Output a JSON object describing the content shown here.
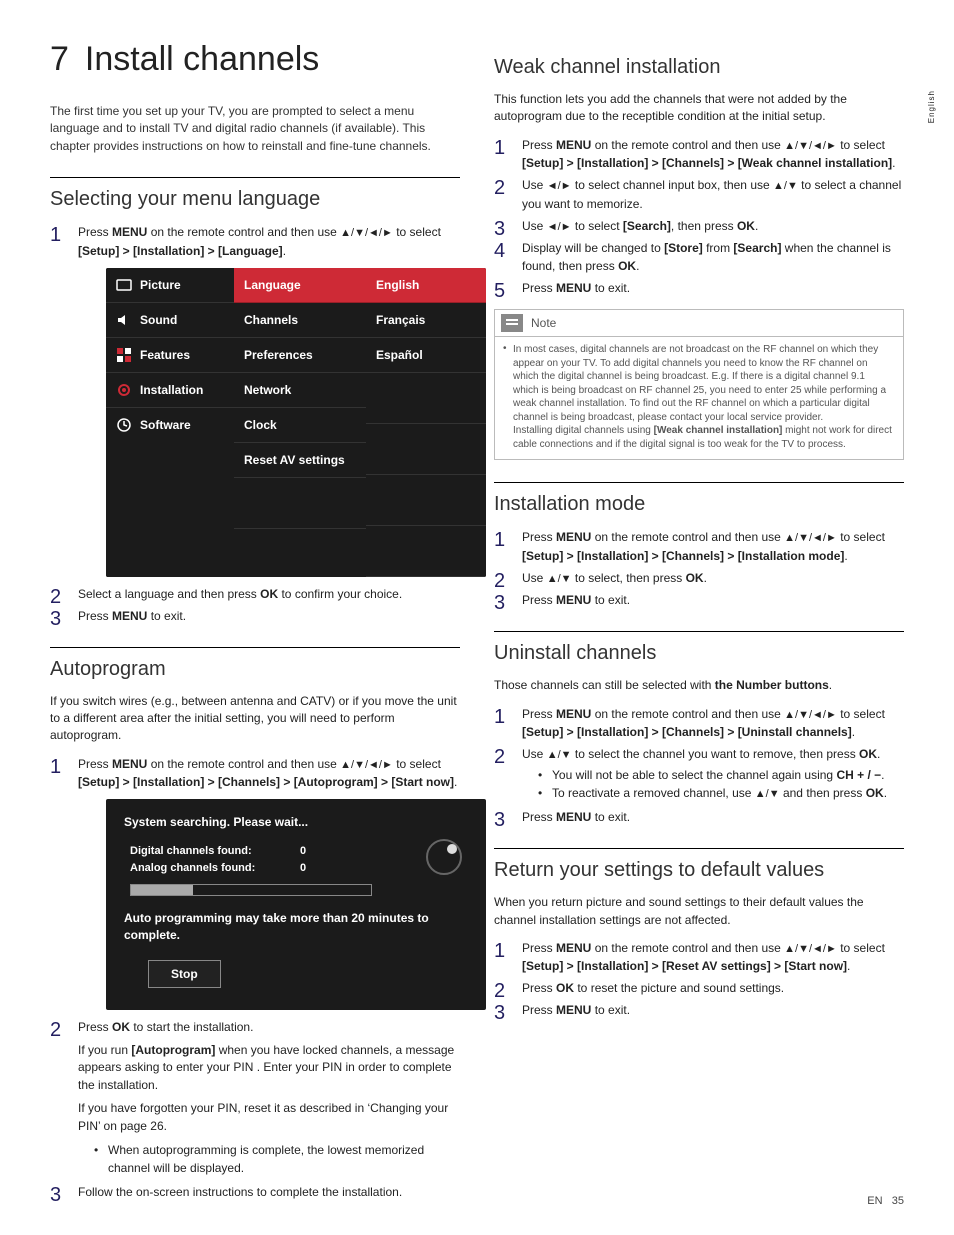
{
  "side_lang": "English",
  "chapter_num": "7",
  "chapter_title": "Install channels",
  "intro": "The first time you set up your TV, you are prompted to select a menu language and to install TV and digital radio channels (if available). This chapter provides instructions on how to reinstall and fine-tune channels.",
  "sec_lang": {
    "title": "Selecting your menu language",
    "step1_a": "Press ",
    "step1_b": "MENU",
    "step1_c": " on the remote control and then use ",
    "step1_arrows": "▲/▼/◄/►",
    "step1_d": " to select ",
    "step1_path": "[Setup] > [Installation] > [Language]",
    "step1_end": ".",
    "menu_left": [
      "Picture",
      "Sound",
      "Features",
      "Installation",
      "Software"
    ],
    "menu_col2_head": "Language",
    "menu_col2": [
      "Channels",
      "Preferences",
      "Network",
      "Clock",
      "Reset AV settings"
    ],
    "menu_col3_head": "English",
    "menu_col3": [
      "Français",
      "Español"
    ],
    "step2": "Select a language and then press OK to confirm your choice.",
    "step3": "Press MENU to exit."
  },
  "sec_auto": {
    "title": "Autoprogram",
    "intro": "If you switch wires (e.g., between antenna and CATV) or if you move the unit to a different area after the initial setting, you will need to perform autoprogram.",
    "step1_a": "Press ",
    "step1_b": "MENU",
    "step1_c": " on the remote control and then use ",
    "step1_arrows": "▲/▼/◄/►",
    "step1_d": " to select ",
    "step1_path": "[Setup] > [Installation] > [Channels] > [Autoprogram] > [Start now]",
    "step1_end": ".",
    "box_title": "System searching. Please wait...",
    "box_digital": "Digital channels found:",
    "box_analog": "Analog channels found:",
    "box_dval": "0",
    "box_aval": "0",
    "box_msg": "Auto programming may take more than 20 minutes to complete.",
    "box_stop": "Stop",
    "step2": "Press OK to start the installation.",
    "sub_a": "If you run [Autoprogram] when you have locked channels, a message appears asking to enter your PIN . Enter your PIN in order to complete the installation.",
    "sub_b": "If you have forgotten your PIN, reset it as described in ‘Changing your PIN’ on page 26.",
    "bullet": "When autoprogramming is complete, the lowest memorized channel will be displayed.",
    "step3": "Follow the on-screen instructions to complete the installation."
  },
  "sec_weak": {
    "title": "Weak channel installation",
    "intro": "This function lets you add the channels that were not added by the autoprogram due to the receptible condition at the initial setup.",
    "step1_a": "Press ",
    "step1_b": "MENU",
    "step1_c": " on the remote control and then use ",
    "step1_arrows": "▲/▼/◄/►",
    "step1_d": " to select ",
    "step1_path": "[Setup] > [Installation] > [Channels] > [Weak channel installation]",
    "step1_end": ".",
    "step2": "Use ◄/► to select channel input box, then use ▲/▼ to select a channel you want to memorize.",
    "step3": "Use ◄/► to select [Search], then press OK.",
    "step4": "Display will be changed to [Store] from [Search] when the channel is found, then press OK.",
    "step5": "Press MENU to exit.",
    "note_title": "Note",
    "note_body_a": "In most cases, digital channels are not broadcast on the RF channel on which they appear on your TV. To add digital channels you need to know the RF channel on which the digital channel is being broadcast. E.g. If there is a digital channel 9.1 which is being broadcast on RF channel 25, you need to enter 25 while performing a weak channel installation. To find out the RF channel on which a particular digital channel is being broadcast, please contact your local service provider.",
    "note_body_b": "Installing digital channels using [Weak channel installation] might not work for direct cable connections and if the digital signal is too weak for the TV to process."
  },
  "sec_mode": {
    "title": "Installation mode",
    "step1_a": "Press ",
    "step1_b": "MENU",
    "step1_c": " on the remote control and then use ",
    "step1_arrows": "▲/▼/◄/►",
    "step1_d": " to select ",
    "step1_path": "[Setup] > [Installation] > [Channels] > [Installation mode]",
    "step1_end": ".",
    "step2": "Use ▲/▼ to select, then press OK.",
    "step3": "Press MENU to exit."
  },
  "sec_uninstall": {
    "title": "Uninstall channels",
    "intro": "Those channels can still be selected with the Number buttons.",
    "step1_a": "Press ",
    "step1_b": "MENU",
    "step1_c": " on the remote control and then use ",
    "step1_arrows": "▲/▼/◄/►",
    "step1_d": " to select ",
    "step1_path": "[Setup] > [Installation] > [Channels] > [Uninstall channels]",
    "step1_end": ".",
    "step2": "Use ▲/▼ to select the channel you want to remove, then press OK.",
    "bullet1": "You will not be able to select the channel again using CH + / −.",
    "bullet2": "To reactivate a removed channel, use ▲/▼ and then press OK.",
    "step3": "Press MENU to exit."
  },
  "sec_reset": {
    "title": "Return your settings to default values",
    "intro": "When you return picture and sound settings to their default values the channel installation settings are not affected.",
    "step1_a": "Press ",
    "step1_b": "MENU",
    "step1_c": " on the remote control and then use ",
    "step1_arrows": "▲/▼/◄/►",
    "step1_d": " to select ",
    "step1_path": "[Setup] > [Installation] > [Reset AV settings] > [Start now]",
    "step1_end": ".",
    "step2": "Press OK to reset the picture and sound settings.",
    "step3": "Press MENU to exit."
  },
  "footer_lang": "EN",
  "footer_page": "35"
}
